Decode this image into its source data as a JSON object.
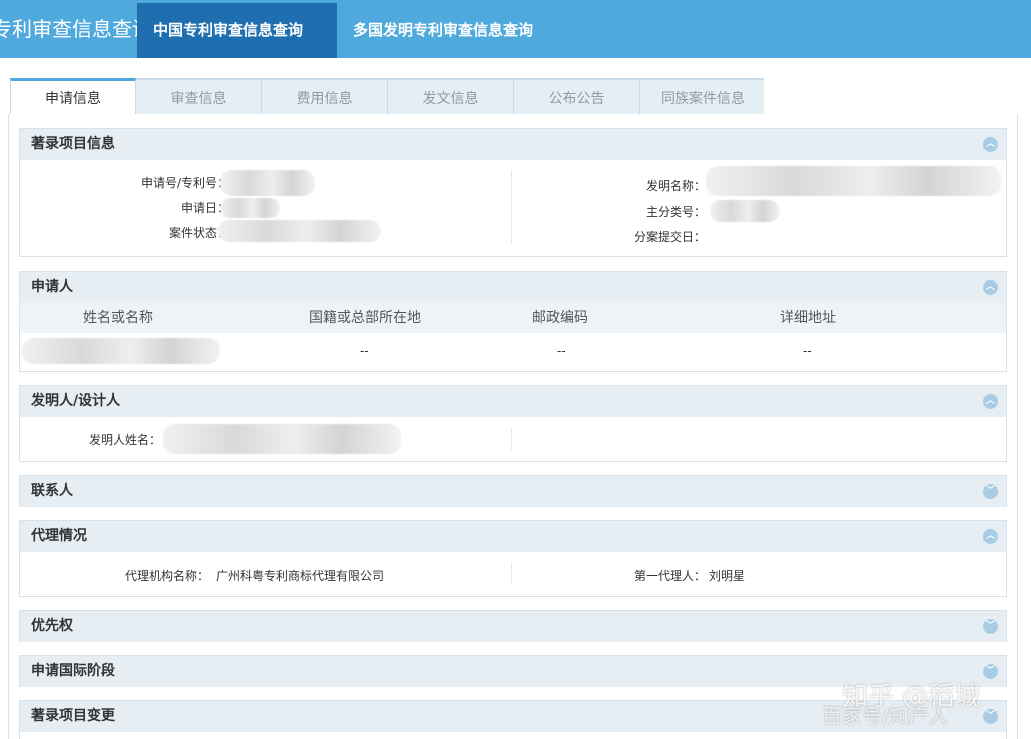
{
  "header": {
    "brand": "专利审查信息查询",
    "nav": [
      "中国专利审查信息查询",
      "多国发明专利审查信息查询"
    ]
  },
  "tabs": [
    "申请信息",
    "审查信息",
    "费用信息",
    "发文信息",
    "公布公告",
    "同族案件信息"
  ],
  "sections": {
    "bibliographic": {
      "title": "著录项目信息",
      "fields_left": [
        "申请号/专利号：",
        "申请日：",
        "案件状态："
      ],
      "fields_right": [
        "发明名称：",
        "主分类号：",
        "分案提交日："
      ]
    },
    "applicant": {
      "title": "申请人",
      "columns": [
        "姓名或名称",
        "国籍或总部所在地",
        "邮政编码",
        "详细地址"
      ],
      "row": [
        "--",
        "--",
        "--"
      ]
    },
    "inventor": {
      "title": "发明人/设计人",
      "label": "发明人姓名："
    },
    "contact": {
      "title": "联系人"
    },
    "agency": {
      "title": "代理情况",
      "agency_label": "代理机构名称：",
      "agency_value": "广州科粤专利商标代理有限公司",
      "agent_label": "第一代理人：",
      "agent_value": "刘明星"
    },
    "priority": {
      "title": "优先权"
    },
    "intl_stage": {
      "title": "申请国际阶段"
    },
    "changes": {
      "title": "著录项目变更"
    }
  },
  "watermark": {
    "line1": "知乎 @稻城",
    "line2": "百家号/知产人"
  },
  "colors": {
    "header_bg": "#4fa9dd",
    "header_active": "#1f6fb0",
    "section_head_bg": "#e6edf3",
    "toggle": "#a9cbe4"
  }
}
